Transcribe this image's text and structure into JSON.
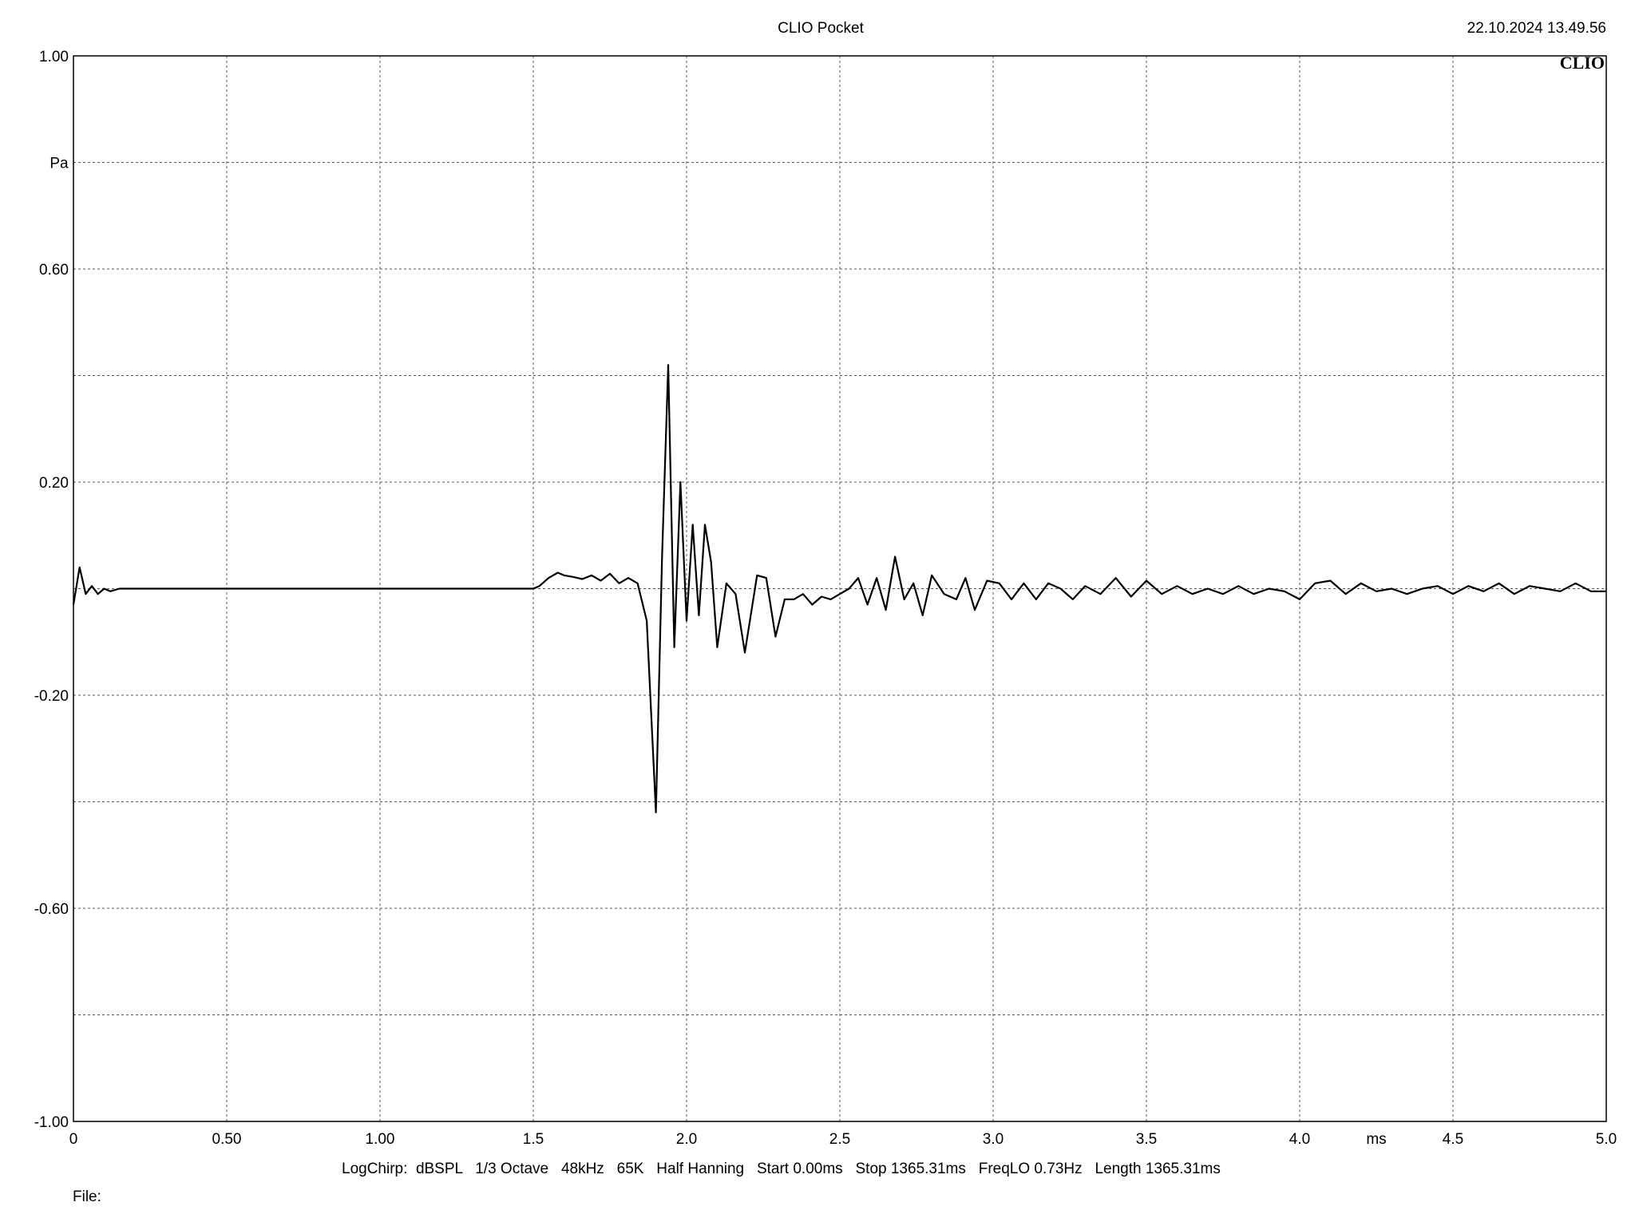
{
  "header": {
    "title": "CLIO Pocket",
    "timestamp": "22.10.2024 13.49.56",
    "logo": "CLIO"
  },
  "footer": {
    "settings": "LogChirp:  dBSPL   1/3 Octave   48kHz   65K   Half Hanning   Start 0.00ms   Stop 1365.31ms   FreqLO 0.73Hz   Length 1365.31ms",
    "file_label": "File:"
  },
  "chart_data": {
    "type": "line",
    "title": "",
    "xlabel": "ms",
    "ylabel": "Pa",
    "xlim": [
      0,
      5.0
    ],
    "ylim": [
      -1.0,
      1.0
    ],
    "grid": true,
    "line_color": "#000000",
    "x_ticks": [
      {
        "value": 0,
        "label": "0"
      },
      {
        "value": 0.5,
        "label": "0.50"
      },
      {
        "value": 1.0,
        "label": "1.00"
      },
      {
        "value": 1.5,
        "label": "1.5"
      },
      {
        "value": 2.0,
        "label": "2.0"
      },
      {
        "value": 2.5,
        "label": "2.5"
      },
      {
        "value": 3.0,
        "label": "3.0"
      },
      {
        "value": 3.5,
        "label": "3.5"
      },
      {
        "value": 4.0,
        "label": "4.0"
      },
      {
        "value": 4.5,
        "label": "4.5"
      },
      {
        "value": 5.0,
        "label": "5.0"
      }
    ],
    "x_unit_position": 4.25,
    "y_ticks": [
      {
        "value": 1.0,
        "label": "1.00"
      },
      {
        "value": 0.6,
        "label": "0.60"
      },
      {
        "value": 0.2,
        "label": "0.20"
      },
      {
        "value": -0.2,
        "label": "-0.20"
      },
      {
        "value": -0.6,
        "label": "-0.60"
      },
      {
        "value": -1.0,
        "label": "-1.00"
      }
    ],
    "y_unit_position": 0.8,
    "y_grid": [
      0.8,
      0.6,
      0.4,
      0.2,
      0.0,
      -0.2,
      -0.4,
      -0.6,
      -0.8
    ],
    "series": [
      {
        "x": [
          0.0,
          0.02,
          0.04,
          0.06,
          0.08,
          0.1,
          0.12,
          0.15,
          0.2,
          0.3,
          0.4,
          0.5,
          0.7,
          0.9,
          1.1,
          1.3,
          1.4,
          1.45,
          1.5,
          1.52,
          1.55,
          1.58,
          1.6,
          1.63,
          1.66,
          1.69,
          1.72,
          1.75,
          1.78,
          1.81,
          1.84,
          1.87,
          1.9,
          1.92,
          1.94,
          1.96,
          1.98,
          2.0,
          2.02,
          2.04,
          2.06,
          2.08,
          2.1,
          2.13,
          2.16,
          2.19,
          2.23,
          2.26,
          2.29,
          2.32,
          2.35,
          2.38,
          2.41,
          2.44,
          2.47,
          2.5,
          2.53,
          2.56,
          2.59,
          2.62,
          2.65,
          2.68,
          2.71,
          2.74,
          2.77,
          2.8,
          2.84,
          2.88,
          2.91,
          2.94,
          2.98,
          3.02,
          3.06,
          3.1,
          3.14,
          3.18,
          3.22,
          3.26,
          3.3,
          3.35,
          3.4,
          3.45,
          3.5,
          3.55,
          3.6,
          3.65,
          3.7,
          3.75,
          3.8,
          3.85,
          3.9,
          3.95,
          4.0,
          4.05,
          4.1,
          4.15,
          4.2,
          4.25,
          4.3,
          4.35,
          4.4,
          4.45,
          4.5,
          4.55,
          4.6,
          4.65,
          4.7,
          4.75,
          4.8,
          4.85,
          4.9,
          4.95,
          5.0
        ],
        "y": [
          -0.03,
          0.04,
          -0.01,
          0.005,
          -0.01,
          0.0,
          -0.005,
          0.0,
          0.0,
          0.0,
          0.0,
          0.0,
          0.0,
          0.0,
          0.0,
          0.0,
          0.0,
          0.0,
          0.0,
          0.005,
          0.02,
          0.03,
          0.025,
          0.022,
          0.018,
          0.025,
          0.015,
          0.028,
          0.01,
          0.02,
          0.01,
          -0.06,
          -0.42,
          0.06,
          0.42,
          -0.11,
          0.2,
          -0.06,
          0.12,
          -0.05,
          0.12,
          0.05,
          -0.11,
          0.01,
          -0.01,
          -0.12,
          0.025,
          0.02,
          -0.09,
          -0.02,
          -0.02,
          -0.01,
          -0.03,
          -0.015,
          -0.02,
          -0.01,
          0.0,
          0.02,
          -0.03,
          0.02,
          -0.04,
          0.06,
          -0.02,
          0.01,
          -0.05,
          0.025,
          -0.01,
          -0.02,
          0.02,
          -0.04,
          0.015,
          0.01,
          -0.02,
          0.01,
          -0.02,
          0.01,
          0.0,
          -0.02,
          0.005,
          -0.01,
          0.02,
          -0.015,
          0.015,
          -0.01,
          0.005,
          -0.01,
          0.0,
          -0.01,
          0.005,
          -0.01,
          0.0,
          -0.005,
          -0.02,
          0.01,
          0.015,
          -0.01,
          0.01,
          -0.005,
          0.0,
          -0.01,
          0.0,
          0.005,
          -0.01,
          0.005,
          -0.005,
          0.01,
          -0.01,
          0.005,
          0.0,
          -0.005,
          0.01,
          -0.005,
          -0.005
        ]
      }
    ]
  }
}
